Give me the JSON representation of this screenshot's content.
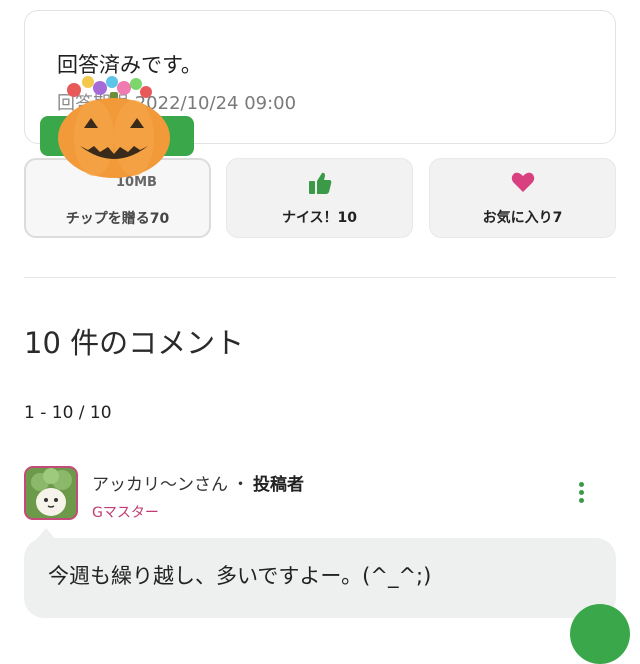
{
  "question": {
    "status": "回答済みです。",
    "deadline_label": "回答期限",
    "deadline_value": "2022/10/24 09:00"
  },
  "actions": {
    "tip_amount": "10MB",
    "tip_label": "チップを贈る70",
    "nice_label": "ナイス！10",
    "favorite_label": "お気に入り7",
    "nice_icon": "thumbs-up-icon",
    "favorite_icon": "heart-icon",
    "tip_icon": "pumpkin-icon"
  },
  "comments": {
    "heading": "10 件のコメント",
    "range": "1 - 10 / 10",
    "first": {
      "user": "アッカリ〜ンさん",
      "separator": "・",
      "role": "投稿者",
      "rank": "Gマスター",
      "text": "今週も繰り越し、多いですよー。(^_^;)"
    }
  },
  "colors": {
    "accent_green": "#3aa84a",
    "rank_pink": "#c23a72",
    "heart_pink": "#d9407f"
  }
}
